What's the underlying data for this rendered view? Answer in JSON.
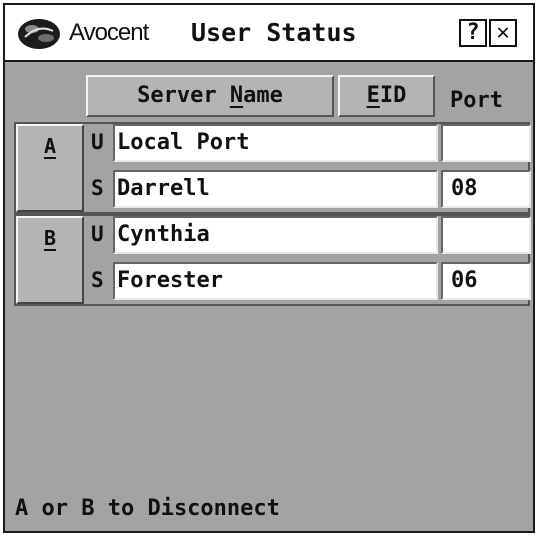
{
  "titlebar": {
    "brand": "Avocent",
    "title": "User Status",
    "help_label": "?",
    "close_label": "✕",
    "icons": [
      "avocent-logo-icon",
      "help-icon",
      "close-icon"
    ]
  },
  "columns": {
    "name_prefix": "Server ",
    "name_accel": "N",
    "name_rest": "ame",
    "eid_accel": "E",
    "eid_rest": "ID",
    "port": "Port"
  },
  "groups": [
    {
      "letter": "A",
      "rows": [
        {
          "tag": "U",
          "name": "Local Port",
          "port": ""
        },
        {
          "tag": "S",
          "name": "Darrell",
          "port": "08"
        }
      ]
    },
    {
      "letter": "B",
      "rows": [
        {
          "tag": "U",
          "name": "Cynthia",
          "port": ""
        },
        {
          "tag": "S",
          "name": "Forester",
          "port": "06"
        }
      ]
    }
  ],
  "footer": "A or B to Disconnect",
  "colors": {
    "panel": "#a3a3a3",
    "field": "#ffffff",
    "text": "#111111"
  }
}
